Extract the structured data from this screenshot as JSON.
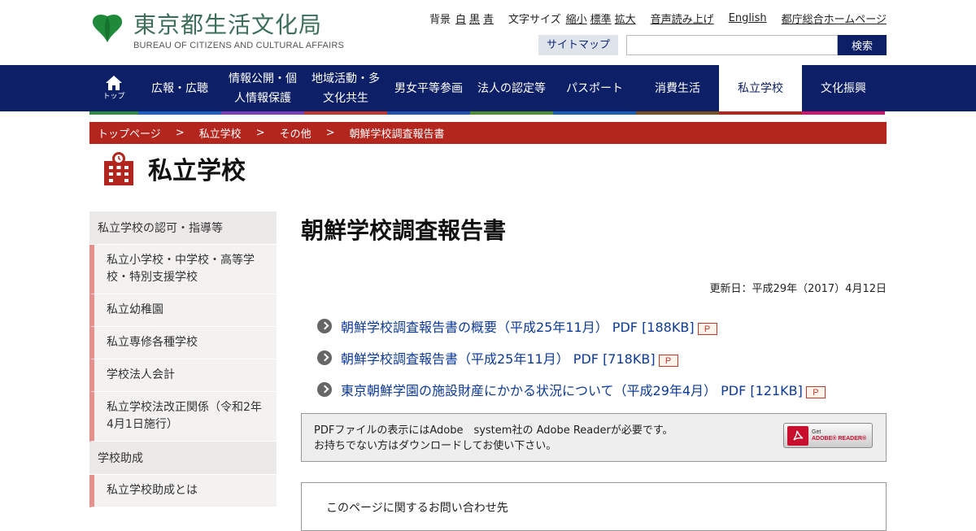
{
  "header": {
    "logo_title": "東京都生活文化局",
    "logo_sub": "BUREAU OF CITIZENS AND CULTURAL AFFAIRS",
    "background_label": "背景",
    "background_options": [
      "白",
      "黒",
      "青"
    ],
    "fontsize_label": "文字サイズ",
    "fontsize_options": [
      "縮小",
      "標準",
      "拡大"
    ],
    "voice_link": "音声読み上げ",
    "english_link": "English",
    "metro_link": "都庁総合ホームページ",
    "sitemap_label": "サイトマップ",
    "search_value": "",
    "search_button": "検索"
  },
  "nav": {
    "home_label": "トップ",
    "items": [
      {
        "label": "広報・広聴"
      },
      {
        "label": "情報公開・個人情報保護"
      },
      {
        "label": "地域活動・多文化共生"
      },
      {
        "label": "男女平等参画"
      },
      {
        "label": "法人の認定等"
      },
      {
        "label": "パスポート"
      },
      {
        "label": "消費生活"
      },
      {
        "label": "私立学校"
      },
      {
        "label": "文化振興"
      }
    ],
    "active_index": 7,
    "accent_colors": [
      "#2e8b3d",
      "#1f5fc4",
      "#7a3fb8",
      "#c0392b",
      "#2251b0",
      "#4f8f2e",
      "#1c5fb0",
      "#7b4f1e",
      "#b3261e",
      "#1646b0",
      "#d4136a"
    ]
  },
  "breadcrumb": [
    "トップページ",
    "私立学校",
    "その他",
    "朝鮮学校調査報告書"
  ],
  "breadcrumb_sep": ">",
  "category": {
    "title": "私立学校",
    "icon": "school-building-icon",
    "color": "#b3261e"
  },
  "sidebar": {
    "sections": [
      {
        "heading": "私立学校の認可・指導等",
        "items": [
          "私立小学校・中学校・高等学校・特別支援学校",
          "私立幼稚園",
          "私立専修各種学校",
          "学校法人会計",
          "私立学校法改正関係（令和2年4月1日施行）"
        ]
      },
      {
        "heading": "学校助成",
        "items": [
          "私立学校助成とは"
        ]
      }
    ]
  },
  "content": {
    "title": "朝鮮学校調査報告書",
    "updated": "更新日：平成29年（2017）4月12日",
    "docs": [
      {
        "label": "朝鮮学校調査報告書の概要（平成25年11月） PDF [188KB]"
      },
      {
        "label": "朝鮮学校調査報告書（平成25年11月） PDF [718KB]"
      },
      {
        "label": "東京朝鮮学園の施設財産にかかる状況について（平成29年4月） PDF [121KB]"
      }
    ],
    "pdf_icon_glyph": "P",
    "adobe_line1": "PDFファイルの表示にはAdobe　system社の Adobe Readerが必要です。",
    "adobe_line2": "お持ちでない方はダウンロードしてお使い下さい。",
    "adobe_badge_get": "Get",
    "adobe_badge_name": "ADOBE® READER®",
    "contact_heading": "このページに関するお問い合わせ先"
  }
}
